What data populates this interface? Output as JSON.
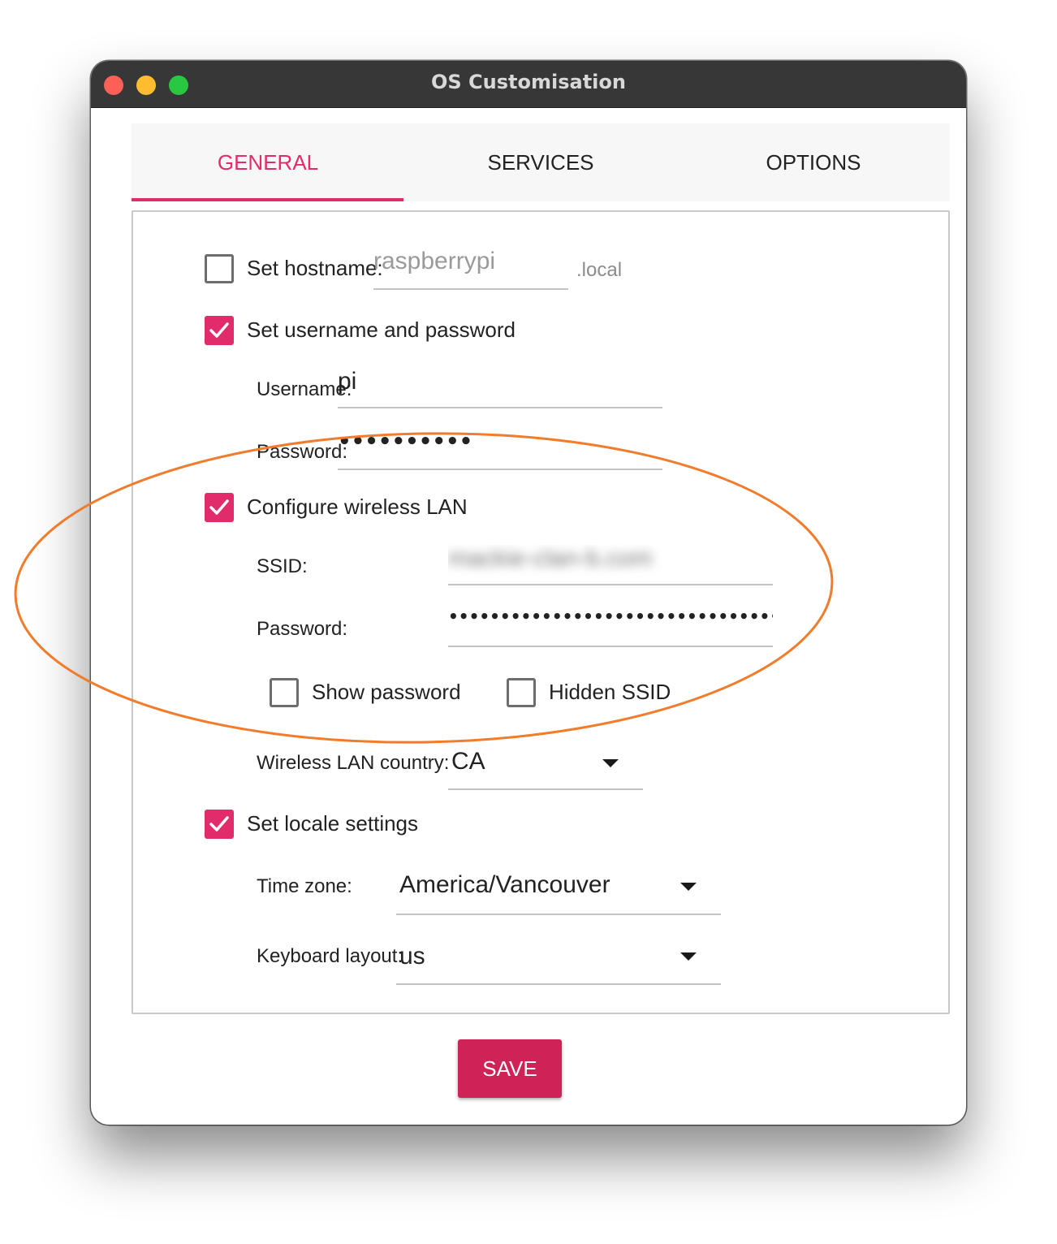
{
  "window": {
    "title": "OS Customisation"
  },
  "tabs": [
    {
      "label": "GENERAL",
      "active": true
    },
    {
      "label": "SERVICES",
      "active": false
    },
    {
      "label": "OPTIONS",
      "active": false
    }
  ],
  "general": {
    "hostname": {
      "label": "Set hostname:",
      "checked": false,
      "placeholder": "raspberrypi",
      "suffix": ".local"
    },
    "user": {
      "label": "Set username and password",
      "checked": true,
      "username_label": "Username:",
      "username_value": "pi",
      "password_label": "Password:",
      "password_value": "••••••••••"
    },
    "wireless": {
      "label": "Configure wireless LAN",
      "checked": true,
      "ssid_label": "SSID:",
      "ssid_value": "mackie-clan-b.com",
      "password_label": "Password:",
      "password_value": "••••••••••••••••••••••••••••••••••••••••",
      "show_password_label": "Show password",
      "show_password_checked": false,
      "hidden_ssid_label": "Hidden SSID",
      "hidden_ssid_checked": false,
      "country_label": "Wireless LAN country:",
      "country_value": "CA"
    },
    "locale": {
      "label": "Set locale settings",
      "checked": true,
      "timezone_label": "Time zone:",
      "timezone_value": "America/Vancouver",
      "keyboard_label": "Keyboard layout:",
      "keyboard_value": "us"
    }
  },
  "save_label": "SAVE",
  "colors": {
    "accent": "#e22b6a",
    "save_button": "#cf2358",
    "annotation": "#f07c2c",
    "titlebar": "#373737"
  },
  "icons": {
    "checkbox_checked": "checkmark-icon",
    "dropdown": "caret-down-icon"
  }
}
